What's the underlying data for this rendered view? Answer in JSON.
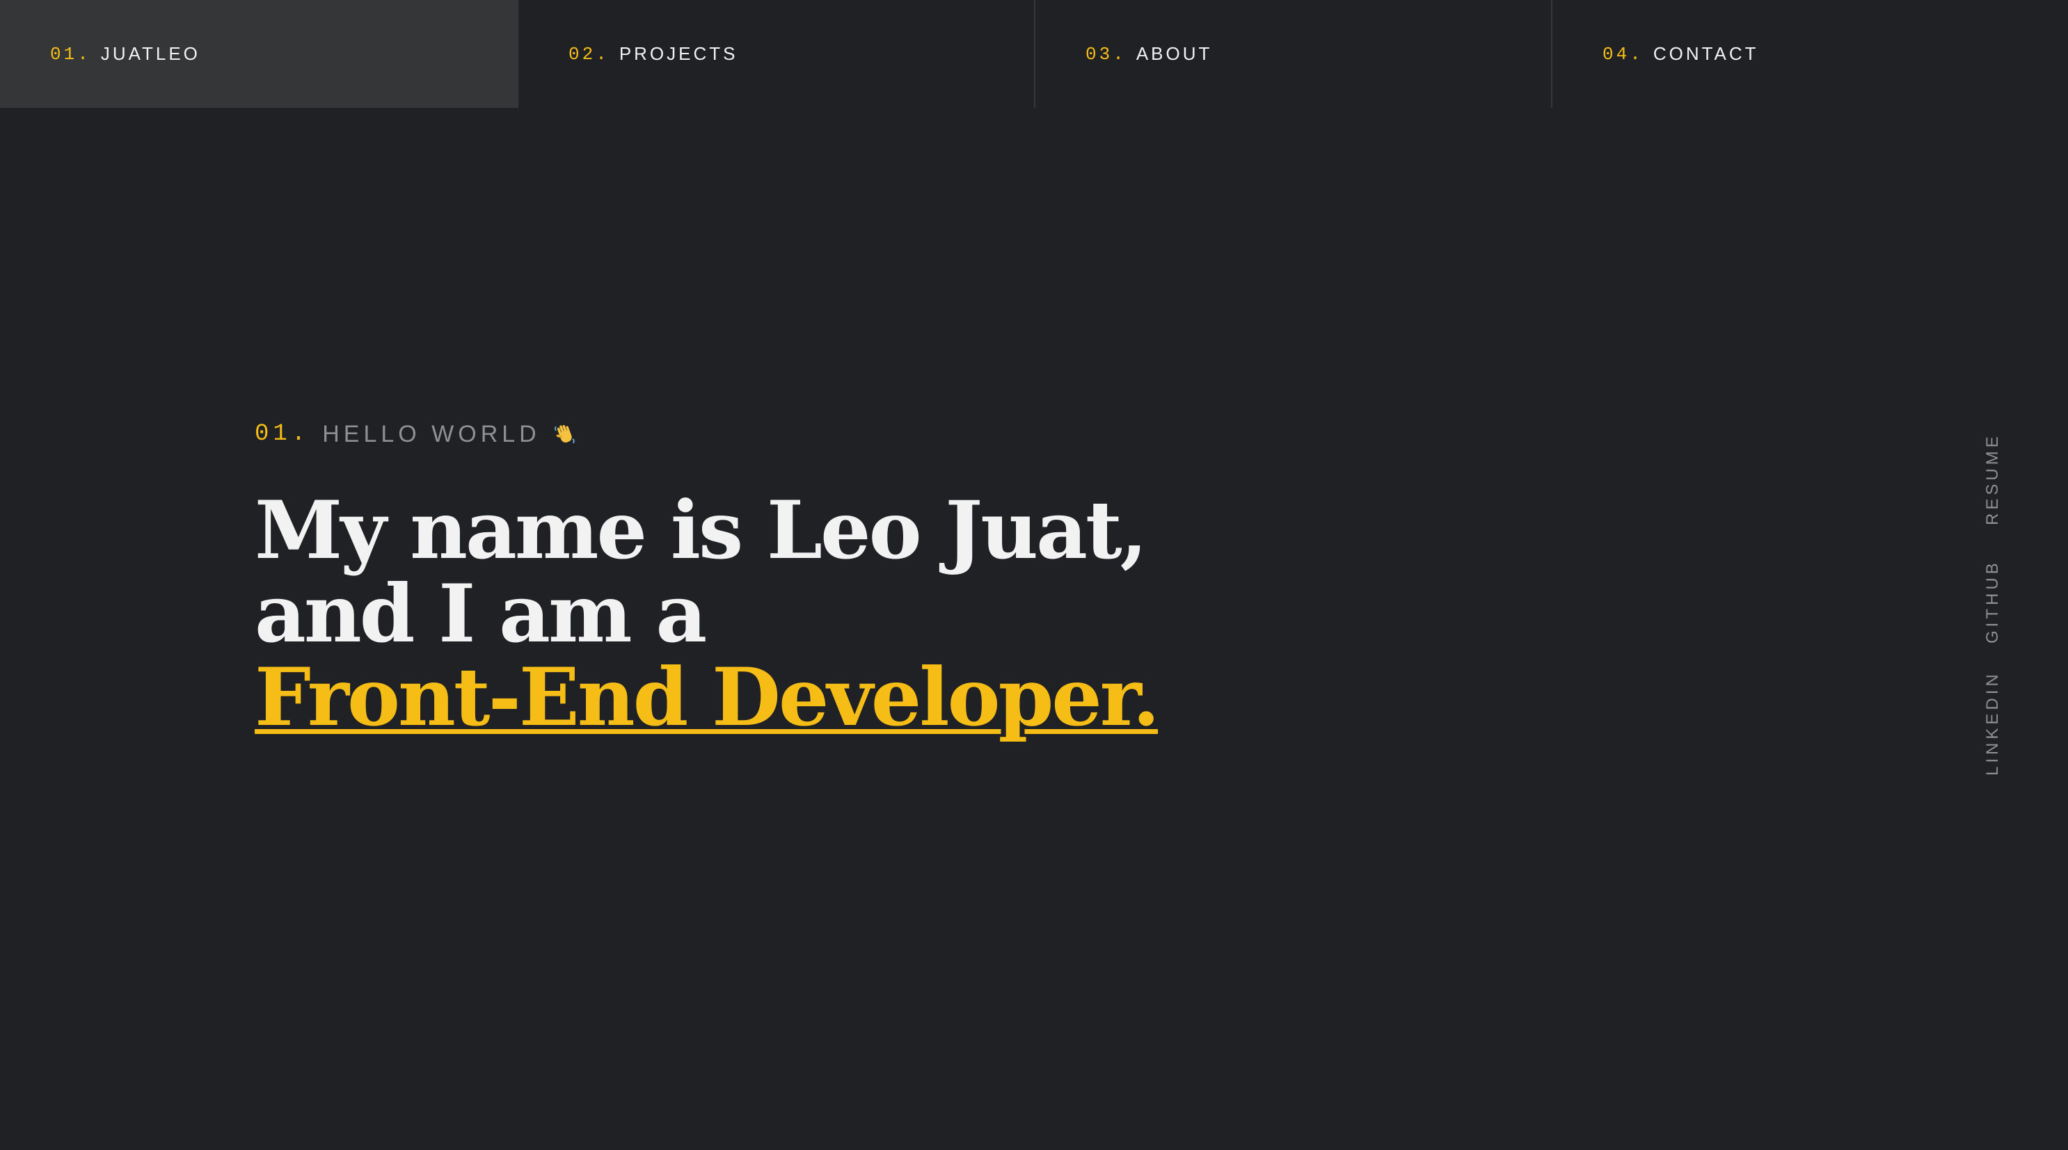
{
  "colors": {
    "background": "#202125",
    "nav_active_bg": "#353638",
    "accent": "#f5bd16",
    "text": "#f2f2f2",
    "muted": "#8f9094"
  },
  "nav": {
    "items": [
      {
        "num": "01.",
        "label": "JUATLEO",
        "active": true
      },
      {
        "num": "02.",
        "label": "PROJECTS",
        "active": false
      },
      {
        "num": "03.",
        "label": "ABOUT",
        "active": false
      },
      {
        "num": "04.",
        "label": "CONTACT",
        "active": false
      }
    ]
  },
  "hero": {
    "eyebrow_num": "01.",
    "eyebrow_text": "HELLO WORLD",
    "eyebrow_icon": "waving-hand-icon",
    "line1": "My name is Leo Juat,",
    "line2": "and I am a",
    "role": "Front-End Developer."
  },
  "social": {
    "resume": "RESUME",
    "github": "GITHUB",
    "linkedin": "LINKEDIN"
  }
}
